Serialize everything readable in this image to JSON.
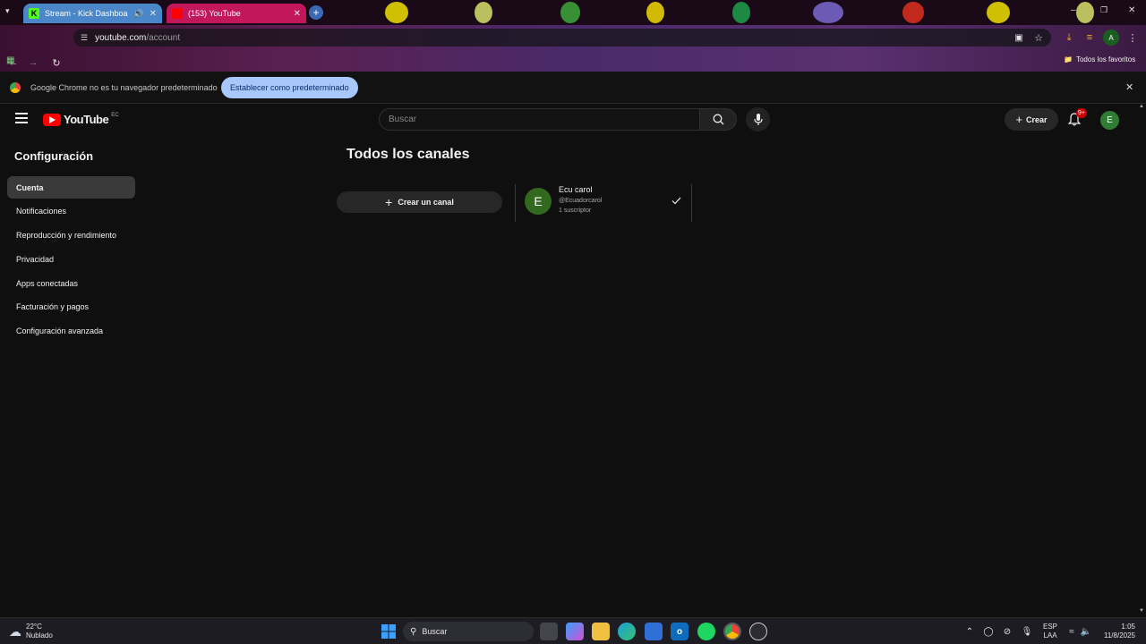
{
  "browser": {
    "tabs": [
      {
        "title": "Stream - Kick Dashboard",
        "favicon_color": "#53fc18",
        "favicon_letter": "K"
      },
      {
        "title": "(153) YouTube",
        "favicon_color": "#ff0000"
      }
    ],
    "new_tab_icon": "plus-icon",
    "url_host": "youtube.com",
    "url_path": "/account",
    "bookmarks_label": "Todos los favoritos",
    "profile_letter": "A"
  },
  "infobar": {
    "message": "Google Chrome no es tu navegador predeterminado",
    "button_label": "Establecer como predeterminado"
  },
  "youtube": {
    "logo_text": "YouTube",
    "country_code": "EC",
    "search_placeholder": "Buscar",
    "create_label": "Crear",
    "notifications_badge": "9+",
    "avatar_letter": "E",
    "avatar_color": "#2e7d32"
  },
  "sidebar": {
    "title": "Configuración",
    "items": [
      {
        "label": "Cuenta",
        "active": true
      },
      {
        "label": "Notificaciones"
      },
      {
        "label": "Reproducción y rendimiento"
      },
      {
        "label": "Privacidad"
      },
      {
        "label": "Apps conectadas"
      },
      {
        "label": "Facturación y pagos"
      },
      {
        "label": "Configuración avanzada"
      }
    ]
  },
  "main": {
    "title": "Todos los canales",
    "create_channel_label": "Crear un canal",
    "channel": {
      "avatar_letter": "E",
      "name": "Ecu carol",
      "handle": "@Ecuadorcarol",
      "subscribers": "1 suscriptor"
    }
  },
  "taskbar": {
    "weather_temp": "22°C",
    "weather_desc": "Nublado",
    "search_label": "Buscar",
    "lang_line1": "ESP",
    "lang_line2": "LAA",
    "time": "1:05",
    "date": "11/8/2025"
  }
}
